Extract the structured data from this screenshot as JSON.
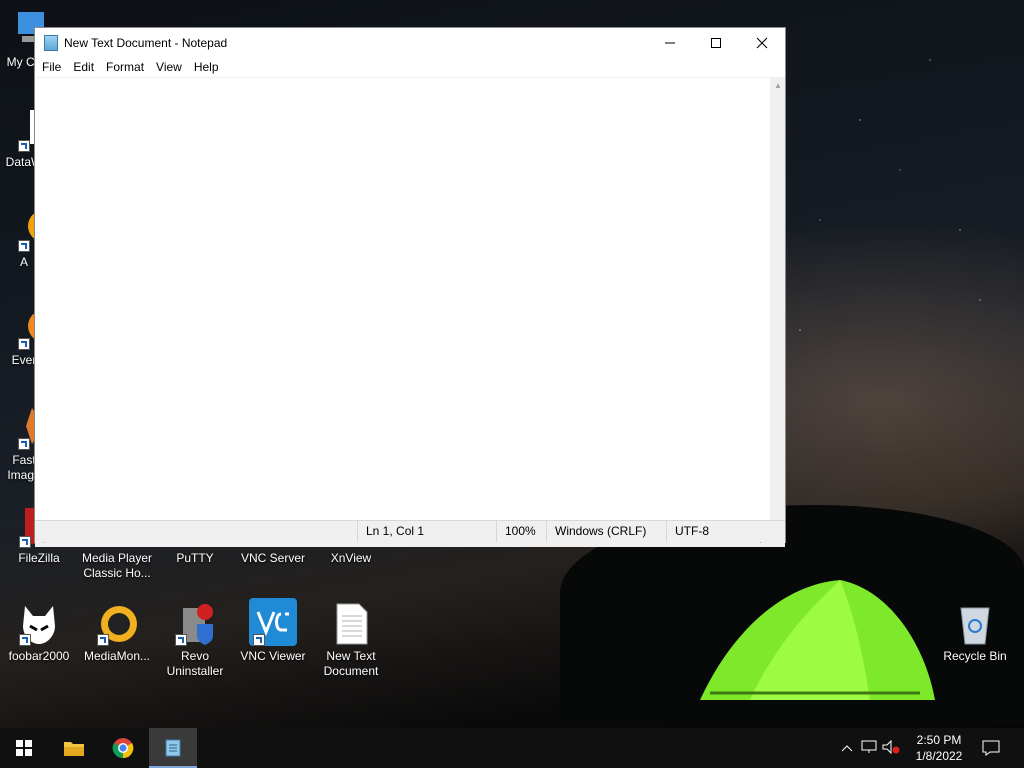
{
  "desktop": {
    "icons": [
      {
        "label": "My Co",
        "label2": ""
      },
      {
        "label": "DataW",
        "label2": ""
      },
      {
        "label": "A",
        "label2": ""
      },
      {
        "label": "Ever",
        "label2": ""
      },
      {
        "label": "Fast",
        "label2": "Image"
      },
      {
        "label": "FileZilla",
        "label2": ""
      },
      {
        "label": "Media Player",
        "label2": "Classic Ho..."
      },
      {
        "label": "PuTTY",
        "label2": ""
      },
      {
        "label": "VNC Server",
        "label2": ""
      },
      {
        "label": "XnView",
        "label2": ""
      },
      {
        "label": "foobar2000",
        "label2": ""
      },
      {
        "label": "MediaMon...",
        "label2": ""
      },
      {
        "label": "Revo",
        "label2": "Uninstaller"
      },
      {
        "label": "VNC Viewer",
        "label2": ""
      },
      {
        "label": "New Text",
        "label2": "Document"
      },
      {
        "label": "Recycle Bin",
        "label2": ""
      }
    ]
  },
  "notepad": {
    "title": "New Text Document - Notepad",
    "menu": [
      "File",
      "Edit",
      "Format",
      "View",
      "Help"
    ],
    "content": "",
    "status": {
      "position": "Ln 1, Col 1",
      "zoom": "100%",
      "line_ending": "Windows (CRLF)",
      "encoding": "UTF-8"
    }
  },
  "taskbar": {
    "clock_time": "2:50 PM",
    "clock_date": "1/8/2022"
  },
  "colors": {
    "accent": "#1a5fb4",
    "taskbar": "#101010",
    "tent_glow": "#8cff28"
  }
}
